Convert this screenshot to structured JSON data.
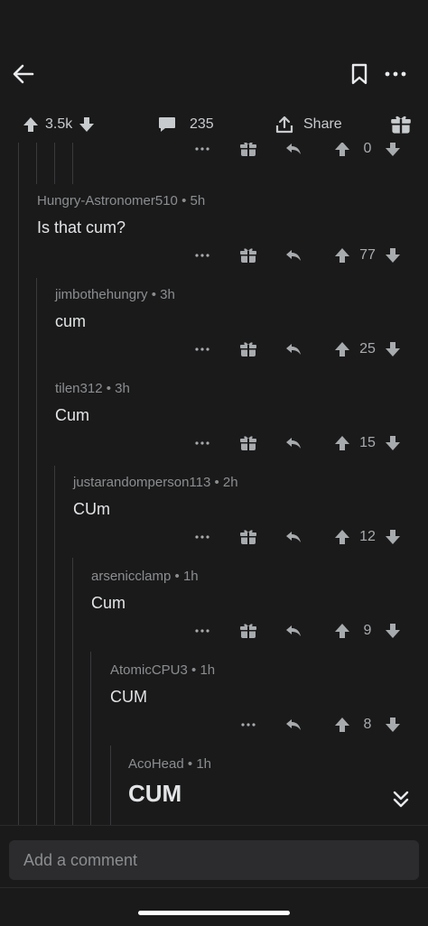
{
  "post_actions": {
    "vote_count": "3.5k",
    "comment_count": "235",
    "share_label": "Share"
  },
  "comments": [
    {
      "author": "",
      "time": "",
      "body": "",
      "score": "0"
    },
    {
      "author": "Hungry-Astronomer510",
      "time": "5h",
      "body": "Is that cum?",
      "score": "77"
    },
    {
      "author": "jimbothehungry",
      "time": "3h",
      "body": "cum",
      "score": "25"
    },
    {
      "author": "tilen312",
      "time": "3h",
      "body": "Cum",
      "score": "15"
    },
    {
      "author": "justarandomperson113",
      "time": "2h",
      "body": "CUm",
      "score": "12"
    },
    {
      "author": "arsenicclamp",
      "time": "1h",
      "body": "Cum",
      "score": "9"
    },
    {
      "author": "AtomicCPU3",
      "time": "1h",
      "body": "CUM",
      "score": "8"
    },
    {
      "author": "AcoHead",
      "time": "1h",
      "body": "CUM",
      "score": ""
    }
  ],
  "comment_input": {
    "placeholder": "Add a comment"
  },
  "icons": {
    "back": "back-arrow-icon",
    "save": "bookmark-icon",
    "more": "more-icon",
    "upvote": "upvote-icon",
    "downvote": "downvote-icon",
    "comment": "comment-icon",
    "share": "share-icon",
    "award": "award-icon",
    "reply": "reply-icon",
    "collapse": "collapse-icon"
  },
  "colors": {
    "background": "#1a1a1b",
    "text": "#d7dadc",
    "muted": "#8b8e90"
  }
}
